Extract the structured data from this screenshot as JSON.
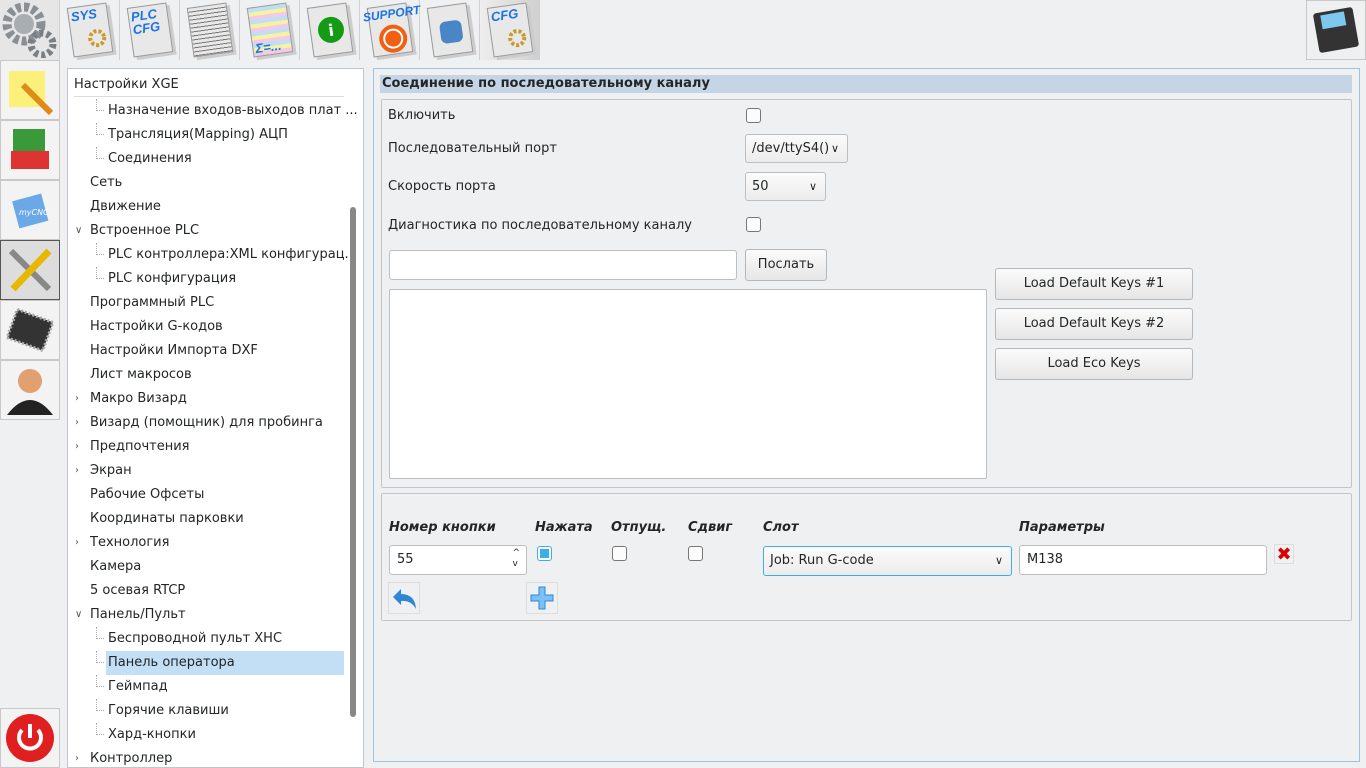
{
  "toolbar": {
    "items": [
      {
        "name": "settings",
        "label": ""
      },
      {
        "name": "sys",
        "label": "SYS"
      },
      {
        "name": "plc-cfg",
        "label": "PLC CFG"
      },
      {
        "name": "document",
        "label": ""
      },
      {
        "name": "formula",
        "label": "Σ=..."
      },
      {
        "name": "info",
        "label": ""
      },
      {
        "name": "support",
        "label": "SUPPORT"
      },
      {
        "name": "database",
        "label": ""
      },
      {
        "name": "cfg",
        "label": "CFG"
      }
    ]
  },
  "sidebar": {
    "items": [
      "edit",
      "book",
      "mycnc",
      "tools",
      "chip",
      "user"
    ]
  },
  "tree": {
    "header": "Настройки XGE",
    "selected": "Панель оператора",
    "items": [
      {
        "label": "Назначение входов-выходов плат ...",
        "level": 2
      },
      {
        "label": "Трансляция(Mapping) АЦП",
        "level": 2
      },
      {
        "label": "Соединения",
        "level": 2
      },
      {
        "label": "Сеть",
        "level": 1
      },
      {
        "label": "Движение",
        "level": 1
      },
      {
        "label": "Встроенное PLC",
        "level": 1,
        "arrow": "expanded"
      },
      {
        "label": "PLC контроллера:XML конфигурац...",
        "level": 2
      },
      {
        "label": "PLC конфигурация",
        "level": 2
      },
      {
        "label": "Программный PLC",
        "level": 1
      },
      {
        "label": "Настройки G-кодов",
        "level": 1
      },
      {
        "label": "Настройки Импорта DXF",
        "level": 1
      },
      {
        "label": "Лист макросов",
        "level": 1
      },
      {
        "label": "Макро Визард",
        "level": 1,
        "arrow": "collapsed"
      },
      {
        "label": "Визард (помощник) для пробинга",
        "level": 1,
        "arrow": "collapsed"
      },
      {
        "label": "Предпочтения",
        "level": 1,
        "arrow": "collapsed"
      },
      {
        "label": "Экран",
        "level": 1,
        "arrow": "collapsed"
      },
      {
        "label": "Рабочие Офсеты",
        "level": 1
      },
      {
        "label": "Координаты парковки",
        "level": 1
      },
      {
        "label": "Технология",
        "level": 1,
        "arrow": "collapsed"
      },
      {
        "label": "Камера",
        "level": 1
      },
      {
        "label": "5 осевая RTCP",
        "level": 1
      },
      {
        "label": "Панель/Пульт",
        "level": 1,
        "arrow": "expanded"
      },
      {
        "label": "Беспроводной пульт XHC",
        "level": 2
      },
      {
        "label": "Панель оператора",
        "level": 2
      },
      {
        "label": "Геймпад",
        "level": 2
      },
      {
        "label": "Горячие клавиши",
        "level": 2
      },
      {
        "label": "Хард-кнопки",
        "level": 2
      },
      {
        "label": "Контроллер",
        "level": 1,
        "arrow": "collapsed"
      }
    ]
  },
  "serial": {
    "title": "Соединение по последовательному каналу",
    "enable_label": "Включить",
    "enable_checked": false,
    "port_label": "Последовательный порт",
    "port_value": "/dev/ttyS4()",
    "speed_label": "Скорость порта",
    "speed_value": "50",
    "diag_label": "Диагностика по последовательному каналу",
    "diag_checked": false,
    "send_input": "",
    "send_button": "Послать",
    "log": "",
    "load1": "Load Default Keys #1",
    "load2": "Load Default Keys #2",
    "load3": "Load Eco Keys"
  },
  "keys": {
    "headers": {
      "number": "Номер кнопки",
      "pressed": "Нажата",
      "released": "Отпущ.",
      "shift": "Сдвиг",
      "slot": "Слот",
      "params": "Параметры"
    },
    "row": {
      "number": "55",
      "pressed": true,
      "released": false,
      "shift": false,
      "slot": "Job: Run G-code",
      "params": "M138"
    }
  },
  "colors": {
    "accent": "#3daee9",
    "selection": "#c2dff5",
    "title_bar": "#c5d5e5",
    "power": "#e02020"
  }
}
